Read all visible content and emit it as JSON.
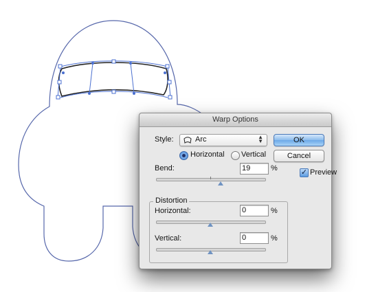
{
  "dialog": {
    "title": "Warp Options",
    "style_label": "Style:",
    "style_value": "Arc",
    "style_icon": "arc-icon",
    "orientation": {
      "horizontal_label": "Horizontal",
      "vertical_label": "Vertical",
      "selected": "horizontal"
    },
    "bend": {
      "label": "Bend:",
      "value": "19",
      "unit": "%",
      "slider_fraction": 0.595
    },
    "distortion": {
      "title": "Distortion",
      "horizontal": {
        "label": "Horizontal:",
        "value": "0",
        "unit": "%",
        "slider_fraction": 0.5
      },
      "vertical": {
        "label": "Vertical:",
        "value": "0",
        "unit": "%",
        "slider_fraction": 0.5
      }
    },
    "buttons": {
      "ok": "OK",
      "cancel": "Cancel"
    },
    "preview": {
      "label": "Preview",
      "checked": true
    }
  },
  "colors": {
    "artwork_outline": "#5566aa",
    "selection": "#4a6fd0",
    "ok_button": "#6ba8e7"
  }
}
